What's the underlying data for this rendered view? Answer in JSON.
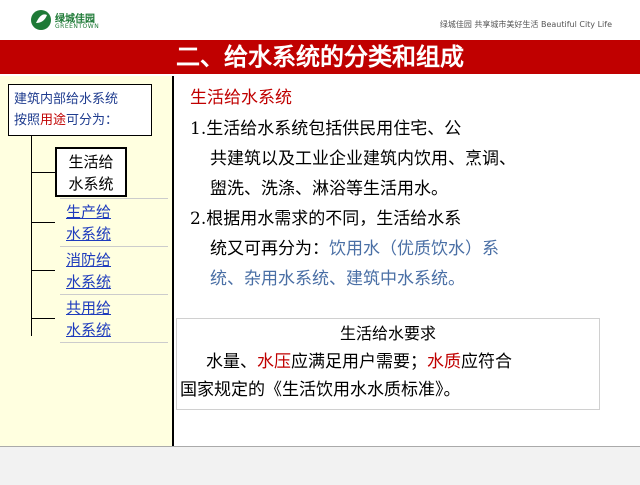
{
  "header": {
    "logo_cn": "绿城佳园",
    "logo_en": "GREENTOWN",
    "tagline": "绿城佳园  共享城市美好生活  Beautiful City Life"
  },
  "title": "二、给水系统的分类和组成",
  "sidebar": {
    "intro_line1": "建筑内部给水系统",
    "intro_line2_a": "按照",
    "intro_line2_b": "用途",
    "intro_line2_c": "可分为：",
    "items": [
      {
        "line1": "生活给",
        "line2": "水系统"
      },
      {
        "line1": "生产给",
        "line2": "水系统"
      },
      {
        "line1": "消防给",
        "line2": "水系统"
      },
      {
        "line1": "共用给",
        "line2": "水系统"
      }
    ]
  },
  "content": {
    "heading": "生活给水系统",
    "p1_l1": "1.生活给水系统包括供民用住宅、公",
    "p1_l2": "共建筑以及工业企业建筑内饮用、烹调、",
    "p1_l3": "盥洗、洗涤、淋浴等生活用水。",
    "p2_l1": "2.根据用水需求的不同，生活给水系",
    "p2_l2_a": "统又可再分为：",
    "p2_l2_b": "饮用水（优质饮水）系",
    "p2_l3": "统、杂用水系统、建筑中水系统。"
  },
  "requirement": {
    "title": "生活给水要求",
    "t1": "水量、",
    "t2": "水压",
    "t3": "应满足用户需要；",
    "t4": "水质",
    "t5": "应符合",
    "l2": "国家规定的《生活饮用水水质标准》。"
  }
}
